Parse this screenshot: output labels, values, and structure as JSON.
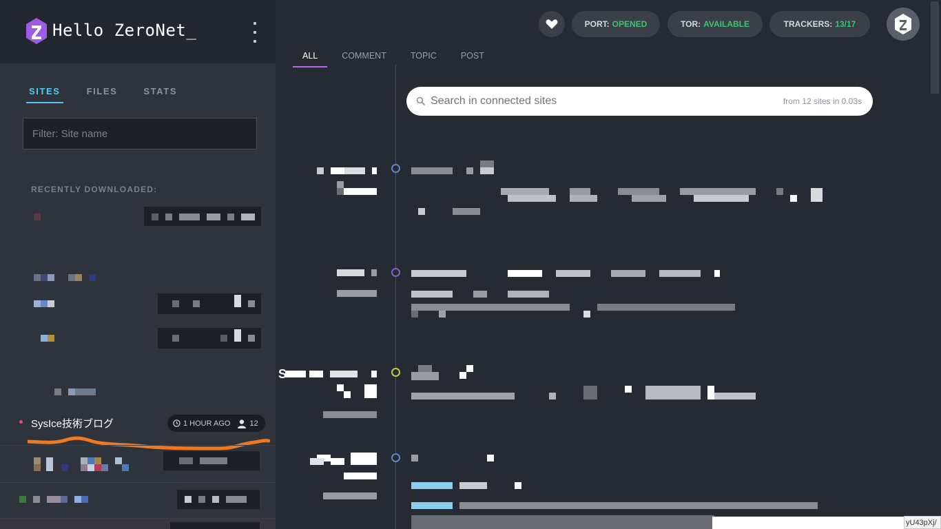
{
  "app": {
    "title": "Hello  ZeroNet_"
  },
  "sidebar": {
    "tabs": [
      {
        "label": "SITES",
        "active": true
      },
      {
        "label": "FILES",
        "active": false
      },
      {
        "label": "STATS",
        "active": false
      }
    ],
    "filter_placeholder": "Filter: Site name",
    "section_label": "RECENTLY DOWNLOADED:",
    "highlighted_site": {
      "name": "SysIce技術ブログ",
      "time_ago": "1 HOUR AGO",
      "peers": "12"
    }
  },
  "status": {
    "port_label": "PORT:",
    "port_value": "OPENED",
    "tor_label": "TOR:",
    "tor_value": "AVAILABLE",
    "trackers_label": "TRACKERS:",
    "trackers_value": "13/17",
    "ok_color": "#3dc46e"
  },
  "feed": {
    "tabs": [
      {
        "label": "ALL",
        "active": true
      },
      {
        "label": "COMMENT",
        "active": false
      },
      {
        "label": "TOPIC",
        "active": false
      },
      {
        "label": "POST",
        "active": false
      }
    ],
    "search_placeholder": "Search in connected sites",
    "search_stats": "from 12 sites in 0.03s",
    "entry_first_char": "S"
  },
  "statusbar": {
    "url_fragment": "yU43pXj/"
  },
  "colors": {
    "accent_purple": "#b36be6",
    "accent_blue": "#5ac8f0",
    "timeline_dot_colors": [
      "#5f86c8",
      "#8a5fc8",
      "#c8cc4a",
      "#5f86c8"
    ]
  }
}
